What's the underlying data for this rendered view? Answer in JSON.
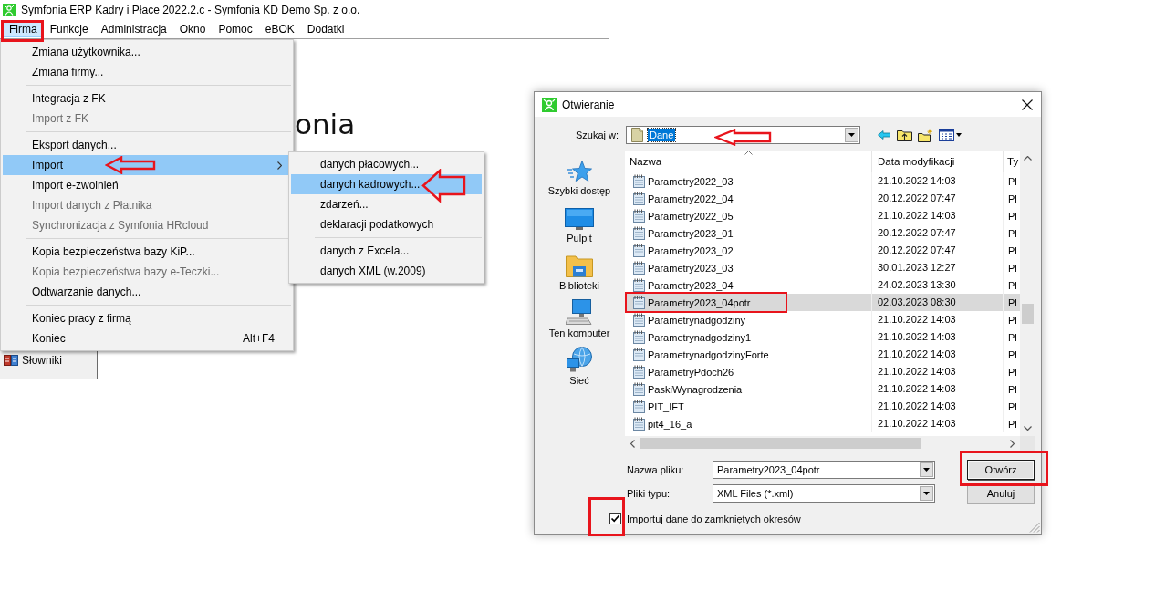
{
  "window": {
    "title": "Symfonia ERP Kadry i Płace 2022.2.c - Symfonia KD Demo Sp. z o.o."
  },
  "menu_bar": [
    {
      "label": "Firma",
      "selected": true,
      "highlight_frame": true
    },
    {
      "label": "Funkcje",
      "selected": false
    },
    {
      "label": "Administracja",
      "selected": false
    },
    {
      "label": "Okno",
      "selected": false
    },
    {
      "label": "Pomoc",
      "selected": false
    },
    {
      "label": "eBOK",
      "selected": false
    },
    {
      "label": "Dodatki",
      "selected": false
    }
  ],
  "menu": {
    "items": [
      {
        "kind": "item",
        "label": "Zmiana użytkownika...",
        "selected": false,
        "disabled": false
      },
      {
        "kind": "item",
        "label": "Zmiana firmy...",
        "selected": false,
        "disabled": false
      },
      {
        "kind": "separator"
      },
      {
        "kind": "item",
        "label": "Integracja z FK",
        "selected": false,
        "disabled": false
      },
      {
        "kind": "item",
        "label": "Import z FK",
        "selected": false,
        "disabled": true
      },
      {
        "kind": "separator"
      },
      {
        "kind": "item",
        "label": "Eksport danych...",
        "selected": false,
        "disabled": false
      },
      {
        "kind": "submenu",
        "label": "Import",
        "selected": true,
        "disabled": false,
        "pointer_arrow": true
      },
      {
        "kind": "item",
        "label": "Import e-zwolnień",
        "selected": false,
        "disabled": false
      },
      {
        "kind": "item",
        "label": "Import danych z Płatnika",
        "selected": false,
        "disabled": true
      },
      {
        "kind": "item",
        "label": "Synchronizacja z Symfonia HRcloud",
        "selected": false,
        "disabled": true
      },
      {
        "kind": "separator"
      },
      {
        "kind": "item",
        "label": "Kopia bezpieczeństwa bazy KiP...",
        "selected": false,
        "disabled": false
      },
      {
        "kind": "item",
        "label": "Kopia bezpieczeństwa bazy e-Teczki...",
        "selected": false,
        "disabled": true
      },
      {
        "kind": "item",
        "label": "Odtwarzanie danych...",
        "selected": false,
        "disabled": false
      },
      {
        "kind": "separator"
      },
      {
        "kind": "item",
        "label": "Koniec pracy z firmą",
        "selected": false,
        "disabled": false
      },
      {
        "kind": "item",
        "label": "Koniec",
        "shortcut": "Alt+F4",
        "selected": false,
        "disabled": false
      }
    ]
  },
  "submenu": {
    "items": [
      {
        "kind": "item",
        "label": "danych płacowych...",
        "selected": false,
        "disabled": false
      },
      {
        "kind": "item",
        "label": "danych kadrowych...",
        "selected": true,
        "disabled": false,
        "pointer_arrow": true
      },
      {
        "kind": "item",
        "label": "zdarzeń...",
        "selected": false,
        "disabled": false
      },
      {
        "kind": "item",
        "label": "deklaracji podatkowych",
        "selected": false,
        "disabled": false
      },
      {
        "kind": "separator"
      },
      {
        "kind": "item",
        "label": "danych z Excela...",
        "selected": false,
        "disabled": false
      },
      {
        "kind": "item",
        "label": "danych XML (w.2009)",
        "selected": false,
        "disabled": false
      }
    ]
  },
  "logo_text": "onia",
  "side_panel": {
    "items": [
      {
        "label": "Słowniki"
      }
    ]
  },
  "dialog": {
    "title": "Otwieranie",
    "look_in": {
      "label": "Szukaj w:",
      "value": "Dane",
      "pointer_arrow": true
    },
    "places": [
      {
        "label": "Szybki dostęp",
        "kind": "quick"
      },
      {
        "label": "Pulpit",
        "kind": "desktop"
      },
      {
        "label": "Biblioteki",
        "kind": "libraries"
      },
      {
        "label": "Ten komputer",
        "kind": "computer"
      },
      {
        "label": "Sieć",
        "kind": "network"
      }
    ],
    "columns": [
      {
        "label": "Nazwa",
        "sorted": true
      },
      {
        "label": "Data modyfikacji",
        "sorted": false
      },
      {
        "label": "Ty",
        "sorted": false
      }
    ],
    "files": [
      {
        "name": "Parametry2022_03",
        "modified": "21.10.2022 14:03",
        "type": "Pl",
        "selected": false
      },
      {
        "name": "Parametry2022_04",
        "modified": "20.12.2022 07:47",
        "type": "Pl",
        "selected": false
      },
      {
        "name": "Parametry2022_05",
        "modified": "21.10.2022 14:03",
        "type": "Pl",
        "selected": false
      },
      {
        "name": "Parametry2023_01",
        "modified": "20.12.2022 07:47",
        "type": "Pl",
        "selected": false
      },
      {
        "name": "Parametry2023_02",
        "modified": "20.12.2022 07:47",
        "type": "Pl",
        "selected": false
      },
      {
        "name": "Parametry2023_03",
        "modified": "30.01.2023 12:27",
        "type": "Pl",
        "selected": false
      },
      {
        "name": "Parametry2023_04",
        "modified": "24.02.2023 13:30",
        "type": "Pl",
        "selected": false
      },
      {
        "name": "Parametry2023_04potr",
        "modified": "02.03.2023 08:30",
        "type": "Pl",
        "selected": true,
        "highlight_frame": true
      },
      {
        "name": "Parametrynadgodziny",
        "modified": "21.10.2022 14:03",
        "type": "Pl",
        "selected": false
      },
      {
        "name": "Parametrynadgodziny1",
        "modified": "21.10.2022 14:03",
        "type": "Pl",
        "selected": false
      },
      {
        "name": "ParametrynadgodzinyForte",
        "modified": "21.10.2022 14:03",
        "type": "Pl",
        "selected": false
      },
      {
        "name": "ParametryPdoch26",
        "modified": "21.10.2022 14:03",
        "type": "Pl",
        "selected": false
      },
      {
        "name": "PaskiWynagrodzenia",
        "modified": "21.10.2022 14:03",
        "type": "Pl",
        "selected": false
      },
      {
        "name": "PIT_IFT",
        "modified": "21.10.2022 14:03",
        "type": "Pl",
        "selected": false
      },
      {
        "name": "pit4_16_a",
        "modified": "21.10.2022 14:03",
        "type": "Pl",
        "selected": false
      }
    ],
    "file_name": {
      "label": "Nazwa pliku:",
      "value": "Parametry2023_04potr"
    },
    "file_type": {
      "label": "Pliki typu:",
      "value": "XML Files (*.xml)"
    },
    "buttons": [
      {
        "label": "Otwórz",
        "default": true,
        "highlight_frame": true
      },
      {
        "label": "Anuluj",
        "default": false
      }
    ],
    "option": {
      "label": "Importuj dane do zamkniętych okresów",
      "checked": true,
      "highlight_frame": true
    }
  }
}
